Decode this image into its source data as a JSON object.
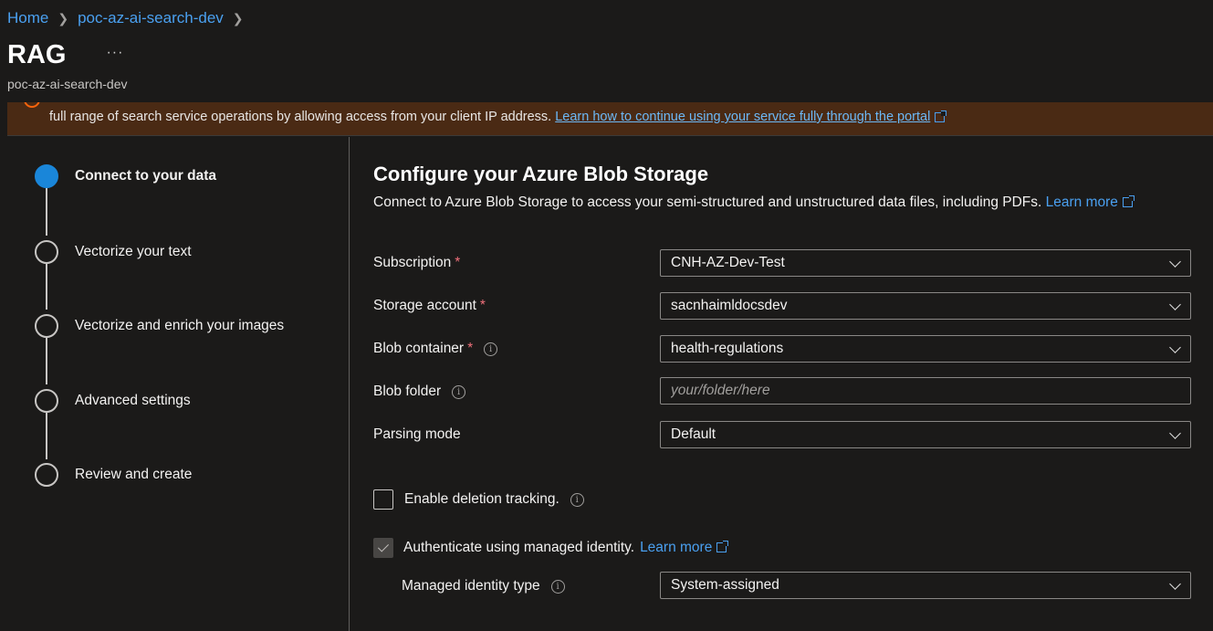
{
  "breadcrumb": {
    "home": "Home",
    "resource": "poc-az-ai-search-dev"
  },
  "header": {
    "title": "RAG",
    "subtitle": "poc-az-ai-search-dev",
    "more": "···"
  },
  "banner": {
    "text": "full range of search service operations by allowing access from your client IP address.",
    "link": "Learn how to continue using your service fully through the portal"
  },
  "steps": [
    {
      "label": "Connect to your data",
      "active": true
    },
    {
      "label": "Vectorize your text",
      "active": false
    },
    {
      "label": "Vectorize and enrich your images",
      "active": false
    },
    {
      "label": "Advanced settings",
      "active": false
    },
    {
      "label": "Review and create",
      "active": false
    }
  ],
  "main": {
    "title": "Configure your Azure Blob Storage",
    "description": "Connect to Azure Blob Storage to access your semi-structured and unstructured data files, including PDFs.",
    "learn_more": "Learn more"
  },
  "form": {
    "subscription": {
      "label": "Subscription",
      "required": "*",
      "value": "CNH-AZ-Dev-Test"
    },
    "storage_account": {
      "label": "Storage account",
      "required": "*",
      "value": "sacnhaimldocsdev"
    },
    "blob_container": {
      "label": "Blob container",
      "required": "*",
      "value": "health-regulations"
    },
    "blob_folder": {
      "label": "Blob folder",
      "value": "",
      "placeholder": "your/folder/here"
    },
    "parsing_mode": {
      "label": "Parsing mode",
      "value": "Default"
    },
    "deletion_tracking": {
      "label": "Enable deletion tracking.",
      "checked": false
    },
    "managed_identity": {
      "label": "Authenticate using managed identity.",
      "learn_more": "Learn more",
      "checked": true
    },
    "identity_type": {
      "label": "Managed identity type",
      "value": "System-assigned"
    }
  },
  "icons": {
    "info": "i"
  },
  "colors": {
    "accent": "#1a86d9",
    "link": "#4aa0f0",
    "banner_bg": "#4a2a14",
    "required": "#f1707b"
  }
}
